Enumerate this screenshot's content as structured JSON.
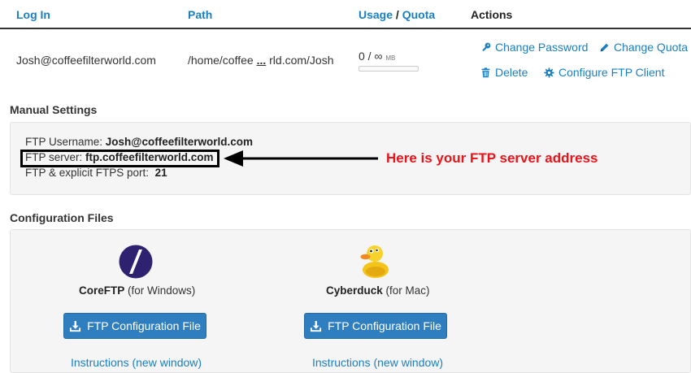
{
  "table": {
    "headers": {
      "login": "Log In",
      "path": "Path",
      "usage": "Usage",
      "slash": "/",
      "quota": "Quota",
      "actions": "Actions"
    },
    "row": {
      "login": "Josh@coffeefilterworld.com",
      "path_start": "/home/coffee",
      "path_ellipsis": "...",
      "path_end": "rld.com/Josh",
      "usage": "0 / ∞",
      "usage_unit": "MB",
      "usage_fraction": 0
    },
    "actions": {
      "change_password": "Change Password",
      "change_quota": "Change Quota",
      "delete": "Delete",
      "configure_ftp": "Configure FTP Client"
    }
  },
  "manual": {
    "title": "Manual Settings",
    "username_label": "FTP Username:",
    "username_value": "Josh@coffeefilterworld.com",
    "server_label": "FTP server:",
    "server_value": "ftp.coffeefilterworld.com",
    "port_label": "FTP & explicit FTPS port:",
    "port_value": "21",
    "annotation": "Here is your FTP server address",
    "annotation_color": "#e8141a"
  },
  "config": {
    "title": "Configuration Files",
    "clients": [
      {
        "name": "CoreFTP",
        "platform": "(for Windows)",
        "button": "FTP Configuration File",
        "link": "Instructions (new window)"
      },
      {
        "name": "Cyberduck",
        "platform": "(for Mac)",
        "button": "FTP Configuration File",
        "link": "Instructions (new window)"
      }
    ]
  },
  "colors": {
    "link": "#1a7fc1",
    "button": "#2f7ec0",
    "panel": "#f5f5f5"
  },
  "icons": {
    "change_password": "key-icon",
    "change_quota": "pencil-icon",
    "delete": "trash-icon",
    "configure_ftp": "gear-icon",
    "download": "download-icon",
    "coreftp": "coreftp-logo",
    "cyberduck": "cyberduck-logo"
  }
}
